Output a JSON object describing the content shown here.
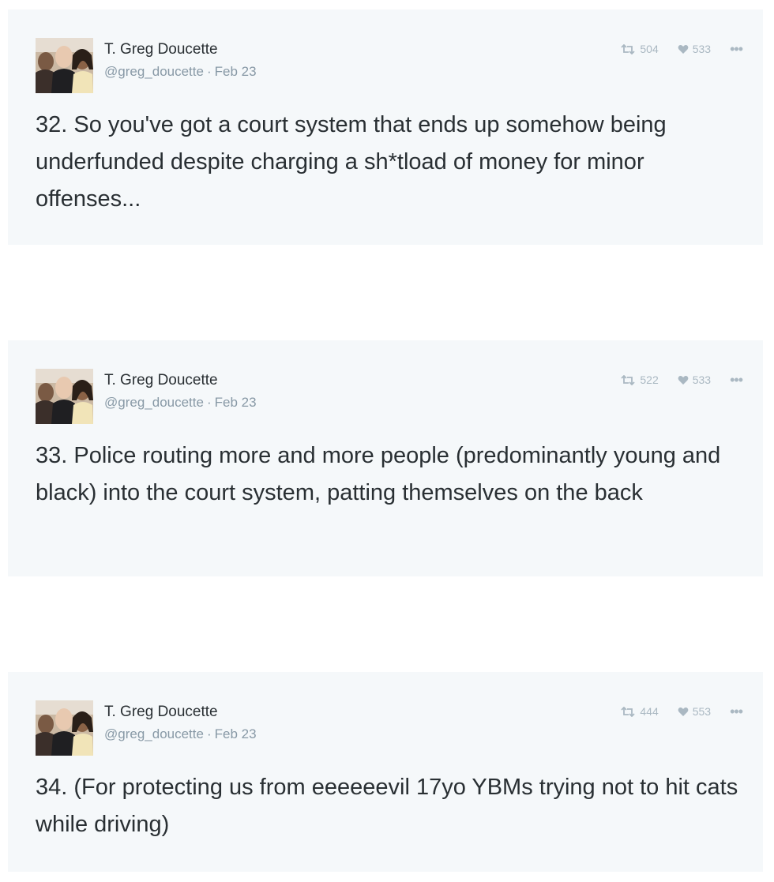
{
  "tweets": [
    {
      "author_name": "T. Greg Doucette",
      "handle": "@greg_doucette",
      "separator": "·",
      "date": "Feb 23",
      "retweets": "504",
      "likes": "533",
      "more": "•••",
      "text": "32. So you've got a court system that ends up somehow being underfunded despite charging a sh*tload of money for minor offenses..."
    },
    {
      "author_name": "T. Greg Doucette",
      "handle": "@greg_doucette",
      "separator": "·",
      "date": "Feb 23",
      "retweets": "522",
      "likes": "533",
      "more": "•••",
      "text": "33. Police routing more and more people (predominantly young and black) into the court system, patting themselves on the back"
    },
    {
      "author_name": "T. Greg Doucette",
      "handle": "@greg_doucette",
      "separator": "·",
      "date": "Feb 23",
      "retweets": "444",
      "likes": "553",
      "more": "•••",
      "text": "34. (For protecting us from eeeeeevil 17yo YBMs trying not to hit cats while driving)"
    }
  ],
  "icons": {
    "retweet": "retweet-icon",
    "like": "heart-icon",
    "more": "more-options-icon"
  },
  "colors": {
    "card_background": "#f5f8fa",
    "text": "#292f33",
    "secondary_text": "#8899a6",
    "action_icons": "#aab8c2"
  }
}
